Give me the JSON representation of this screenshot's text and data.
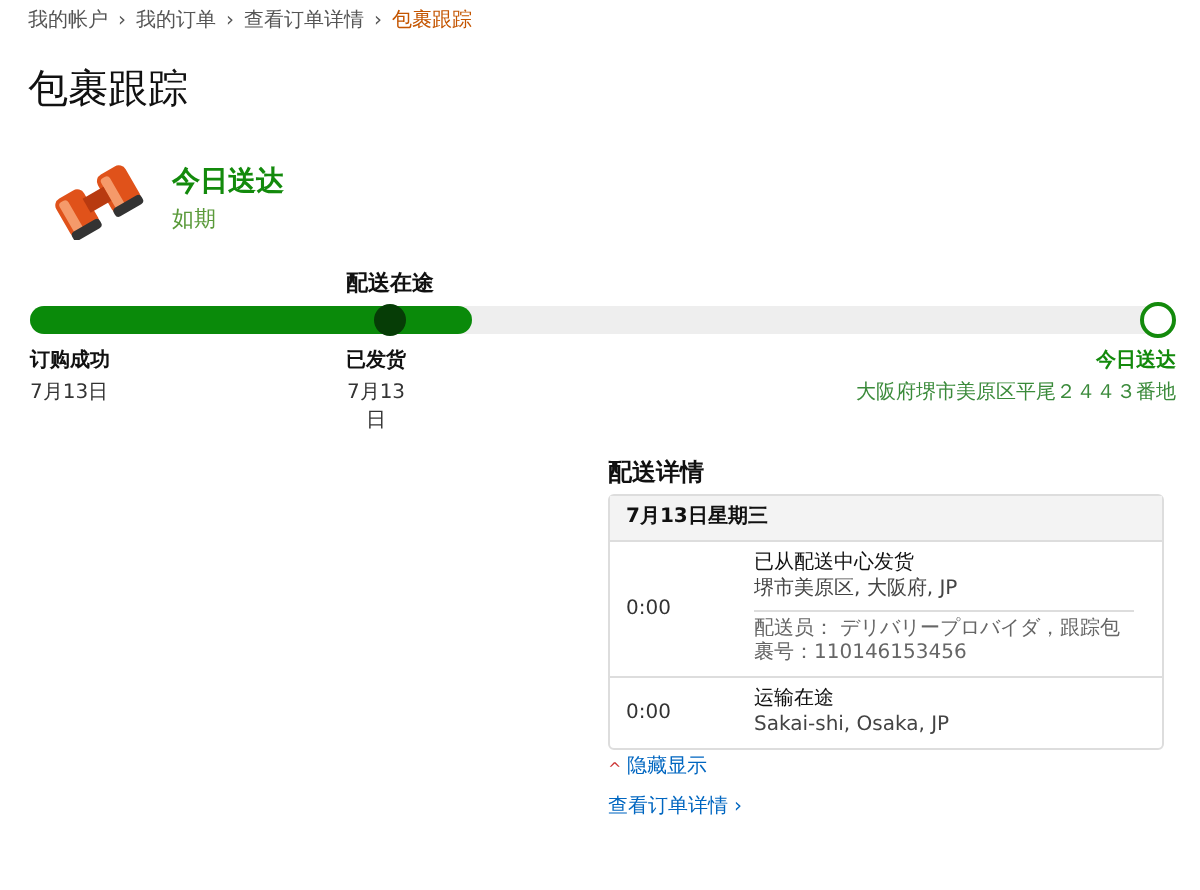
{
  "breadcrumb": [
    {
      "label": "我的帐户",
      "current": false
    },
    {
      "label": "我的订单",
      "current": false
    },
    {
      "label": "查看订单详情",
      "current": false
    },
    {
      "label": "包裹跟踪",
      "current": true
    }
  ],
  "breadcrumb_separator": "›",
  "title": "包裹跟踪",
  "status": {
    "headline": "今日送达",
    "subtitle": "如期"
  },
  "progress": {
    "stage_label": "配送在途",
    "level": 0.39,
    "milestones": [
      {
        "kind": "start",
        "label": "订购成功",
        "detail": "7月13日",
        "current": false
      },
      {
        "kind": "middle",
        "label": "已发货",
        "detail": "7月13日",
        "current": true
      },
      {
        "kind": "destination",
        "label": "今日送达",
        "detail": "大阪府堺市美原区平尾２４４３番地",
        "current": false
      }
    ]
  },
  "details": {
    "title": "配送详情",
    "date": "7月13日星期三",
    "events": [
      {
        "time": "0:00",
        "title": "已从配送中心发货",
        "location": "堺市美原区, 大阪府, JP",
        "note": "配送员： デリバリープロバイダ，跟踪包裹号：110146153456"
      },
      {
        "time": "0:00",
        "title": "运输在途",
        "location": "Sakai-shi, Osaka, JP"
      }
    ],
    "toggle": {
      "caret": "^",
      "label": "隐藏显示"
    },
    "order_link": {
      "label": "查看订单详情",
      "arrow": "›"
    }
  }
}
